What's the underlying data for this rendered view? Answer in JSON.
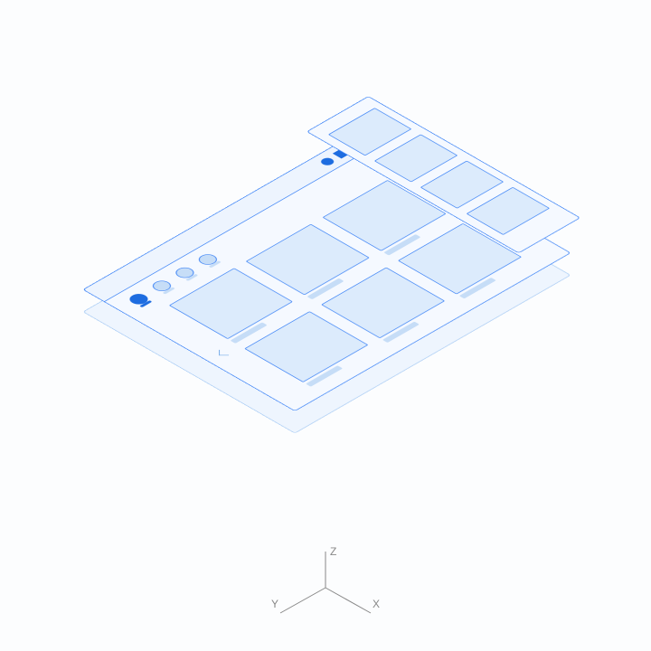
{
  "axes": {
    "z": "Z",
    "y": "Y",
    "x": "X"
  },
  "title_icons": [
    "circle-icon",
    "square-icon",
    "triangle-icon"
  ],
  "avatars": [
    {
      "name": "avatar-1",
      "active": true
    },
    {
      "name": "avatar-2",
      "active": false
    },
    {
      "name": "avatar-3",
      "active": false
    },
    {
      "name": "avatar-4",
      "active": false
    }
  ],
  "grid_cards": 6
}
